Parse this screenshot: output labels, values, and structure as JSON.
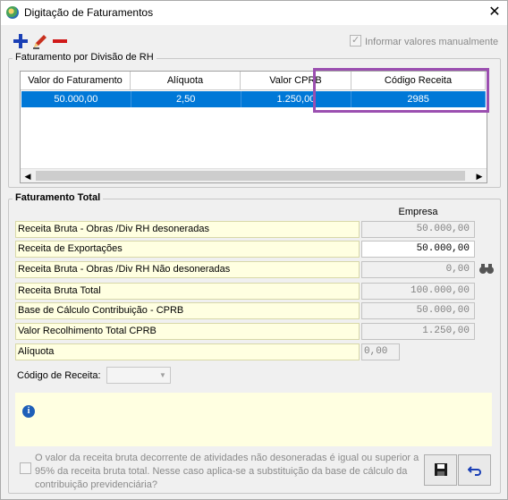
{
  "window": {
    "title": "Digitação de Faturamentos"
  },
  "toolbar": {
    "manual_label": "Informar valores manualmente",
    "manual_checked": true
  },
  "division_group": {
    "legend": "Faturamento por Divisão de RH",
    "columns": [
      "Valor do Faturamento",
      "Alíquota",
      "Valor CPRB",
      "Código Receita"
    ],
    "rows": [
      [
        "50.000,00",
        "2,50",
        "1.250,00",
        "2985"
      ]
    ]
  },
  "total_group": {
    "legend": "Faturamento Total",
    "empresa_header": "Empresa",
    "fields": [
      {
        "label": "Receita Bruta - Obras /Div RH desoneradas",
        "value": "50.000,00"
      },
      {
        "label": "Receita de Exportações",
        "value": "50.000,00"
      },
      {
        "label": "Receita Bruta - Obras /Div RH Não desoneradas",
        "value": "0,00"
      },
      {
        "label": "Receita Bruta Total",
        "value": "100.000,00"
      },
      {
        "label": "Base de Cálculo Contribuição - CPRB",
        "value": "50.000,00"
      },
      {
        "label": "Valor Recolhimento Total CPRB",
        "value": "1.250,00"
      },
      {
        "label": "Alíquota",
        "value": "0,00"
      }
    ],
    "codigo_label": "Código de Receita:",
    "codigo_value": ""
  },
  "notice": {
    "text": "O valor da receita bruta decorrente de atividades não desoneradas é igual ou superior a 95% da receita bruta total. Nesse caso aplica-se a substituição da base de cálculo da contribuição previdenciária?"
  },
  "colors": {
    "accent": "#0078d7",
    "highlight": "#9b4fb0",
    "info_bg": "#ffffe1"
  },
  "icons": [
    "app-icon",
    "close-icon",
    "add-icon",
    "edit-icon",
    "remove-icon",
    "binoculars-icon",
    "info-icon",
    "save-icon",
    "undo-icon"
  ]
}
